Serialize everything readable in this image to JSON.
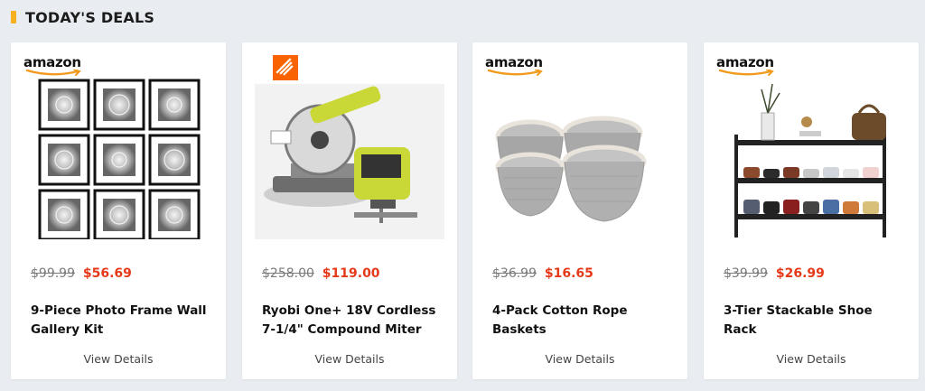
{
  "section": {
    "title": "TODAY'S DEALS"
  },
  "colors": {
    "accent": "#f5b120",
    "sale_price": "#e53a1a",
    "old_price": "#7a7a7a",
    "background": "#e9edf1"
  },
  "deals": [
    {
      "store": "amazon",
      "store_logo": "amazon-logo",
      "image": "photo-frame-gallery-image",
      "old_price": "$99.99",
      "new_price": "$56.69",
      "title": "9-Piece Photo Frame Wall Gallery Kit",
      "link": "View Details"
    },
    {
      "store": "",
      "store_logo": "home-depot-logo",
      "image": "miter-saw-jigsaw-image",
      "old_price": "$258.00",
      "new_price": "$119.00",
      "title": "Ryobi One+ 18V Cordless 7-1/4\" Compound Miter",
      "link": "View Details"
    },
    {
      "store": "amazon",
      "store_logo": "amazon-logo",
      "image": "rope-baskets-image",
      "old_price": "$36.99",
      "new_price": "$16.65",
      "title": "4-Pack Cotton Rope Baskets",
      "link": "View Details"
    },
    {
      "store": "amazon",
      "store_logo": "amazon-logo",
      "image": "shoe-rack-image",
      "old_price": "$39.99",
      "new_price": "$26.99",
      "title": "3-Tier Stackable Shoe Rack",
      "link": "View Details"
    }
  ]
}
